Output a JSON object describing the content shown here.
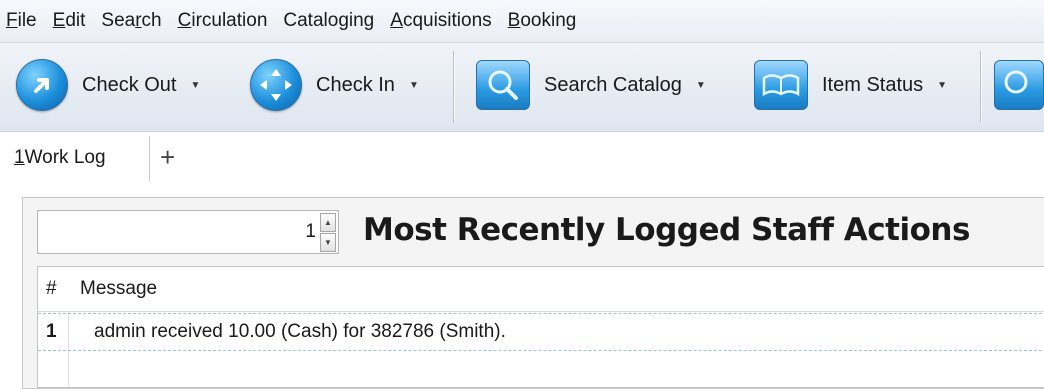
{
  "menubar": {
    "items": [
      {
        "pre": "",
        "acc": "F",
        "post": "ile"
      },
      {
        "pre": "",
        "acc": "E",
        "post": "dit"
      },
      {
        "pre": "Sea",
        "acc": "r",
        "post": "ch"
      },
      {
        "pre": "",
        "acc": "C",
        "post": "irculation"
      },
      {
        "pre": "Catalo",
        "acc": "g",
        "post": "ing"
      },
      {
        "pre": "",
        "acc": "A",
        "post": "cquisitions"
      },
      {
        "pre": "",
        "acc": "B",
        "post": "ooking"
      }
    ]
  },
  "toolbar": {
    "check_out": {
      "label": "Check Out",
      "icon": "arrow-circle-icon"
    },
    "check_in": {
      "label": "Check In",
      "icon": "arrows-in-icon"
    },
    "search_catalog": {
      "label": "Search Catalog",
      "icon": "magnifier-icon"
    },
    "item_status": {
      "label": "Item Status",
      "icon": "book-icon"
    },
    "caret": "▼",
    "colors": {
      "accent": "#1d8fdb"
    }
  },
  "tabs": {
    "active": {
      "acc": "1",
      "rest": " Work Log"
    },
    "add_symbol": "+"
  },
  "worklog": {
    "count_value": "1",
    "heading": "Most Recently Logged Staff Actions",
    "columns": {
      "num": "#",
      "message": "Message"
    },
    "rows": [
      {
        "num": "1",
        "message": "admin received 10.00 (Cash) for 382786 (Smith)."
      }
    ]
  }
}
